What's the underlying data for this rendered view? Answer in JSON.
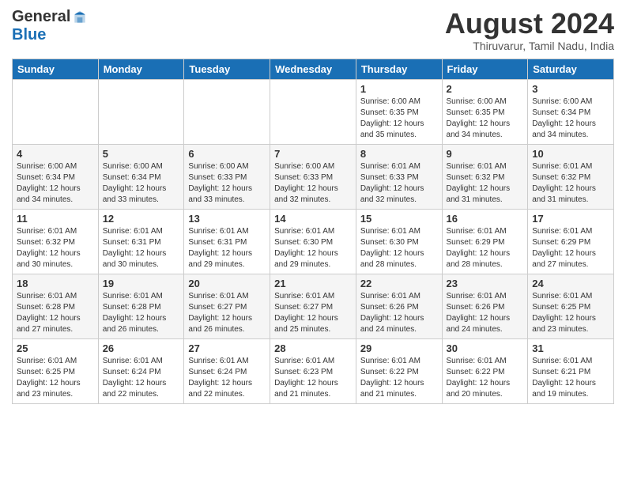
{
  "logo": {
    "general": "General",
    "blue": "Blue"
  },
  "header": {
    "title": "August 2024",
    "subtitle": "Thiruvarur, Tamil Nadu, India"
  },
  "days_of_week": [
    "Sunday",
    "Monday",
    "Tuesday",
    "Wednesday",
    "Thursday",
    "Friday",
    "Saturday"
  ],
  "weeks": [
    [
      {
        "num": "",
        "info": ""
      },
      {
        "num": "",
        "info": ""
      },
      {
        "num": "",
        "info": ""
      },
      {
        "num": "",
        "info": ""
      },
      {
        "num": "1",
        "info": "Sunrise: 6:00 AM\nSunset: 6:35 PM\nDaylight: 12 hours\nand 35 minutes."
      },
      {
        "num": "2",
        "info": "Sunrise: 6:00 AM\nSunset: 6:35 PM\nDaylight: 12 hours\nand 34 minutes."
      },
      {
        "num": "3",
        "info": "Sunrise: 6:00 AM\nSunset: 6:34 PM\nDaylight: 12 hours\nand 34 minutes."
      }
    ],
    [
      {
        "num": "4",
        "info": "Sunrise: 6:00 AM\nSunset: 6:34 PM\nDaylight: 12 hours\nand 34 minutes."
      },
      {
        "num": "5",
        "info": "Sunrise: 6:00 AM\nSunset: 6:34 PM\nDaylight: 12 hours\nand 33 minutes."
      },
      {
        "num": "6",
        "info": "Sunrise: 6:00 AM\nSunset: 6:33 PM\nDaylight: 12 hours\nand 33 minutes."
      },
      {
        "num": "7",
        "info": "Sunrise: 6:00 AM\nSunset: 6:33 PM\nDaylight: 12 hours\nand 32 minutes."
      },
      {
        "num": "8",
        "info": "Sunrise: 6:01 AM\nSunset: 6:33 PM\nDaylight: 12 hours\nand 32 minutes."
      },
      {
        "num": "9",
        "info": "Sunrise: 6:01 AM\nSunset: 6:32 PM\nDaylight: 12 hours\nand 31 minutes."
      },
      {
        "num": "10",
        "info": "Sunrise: 6:01 AM\nSunset: 6:32 PM\nDaylight: 12 hours\nand 31 minutes."
      }
    ],
    [
      {
        "num": "11",
        "info": "Sunrise: 6:01 AM\nSunset: 6:32 PM\nDaylight: 12 hours\nand 30 minutes."
      },
      {
        "num": "12",
        "info": "Sunrise: 6:01 AM\nSunset: 6:31 PM\nDaylight: 12 hours\nand 30 minutes."
      },
      {
        "num": "13",
        "info": "Sunrise: 6:01 AM\nSunset: 6:31 PM\nDaylight: 12 hours\nand 29 minutes."
      },
      {
        "num": "14",
        "info": "Sunrise: 6:01 AM\nSunset: 6:30 PM\nDaylight: 12 hours\nand 29 minutes."
      },
      {
        "num": "15",
        "info": "Sunrise: 6:01 AM\nSunset: 6:30 PM\nDaylight: 12 hours\nand 28 minutes."
      },
      {
        "num": "16",
        "info": "Sunrise: 6:01 AM\nSunset: 6:29 PM\nDaylight: 12 hours\nand 28 minutes."
      },
      {
        "num": "17",
        "info": "Sunrise: 6:01 AM\nSunset: 6:29 PM\nDaylight: 12 hours\nand 27 minutes."
      }
    ],
    [
      {
        "num": "18",
        "info": "Sunrise: 6:01 AM\nSunset: 6:28 PM\nDaylight: 12 hours\nand 27 minutes."
      },
      {
        "num": "19",
        "info": "Sunrise: 6:01 AM\nSunset: 6:28 PM\nDaylight: 12 hours\nand 26 minutes."
      },
      {
        "num": "20",
        "info": "Sunrise: 6:01 AM\nSunset: 6:27 PM\nDaylight: 12 hours\nand 26 minutes."
      },
      {
        "num": "21",
        "info": "Sunrise: 6:01 AM\nSunset: 6:27 PM\nDaylight: 12 hours\nand 25 minutes."
      },
      {
        "num": "22",
        "info": "Sunrise: 6:01 AM\nSunset: 6:26 PM\nDaylight: 12 hours\nand 24 minutes."
      },
      {
        "num": "23",
        "info": "Sunrise: 6:01 AM\nSunset: 6:26 PM\nDaylight: 12 hours\nand 24 minutes."
      },
      {
        "num": "24",
        "info": "Sunrise: 6:01 AM\nSunset: 6:25 PM\nDaylight: 12 hours\nand 23 minutes."
      }
    ],
    [
      {
        "num": "25",
        "info": "Sunrise: 6:01 AM\nSunset: 6:25 PM\nDaylight: 12 hours\nand 23 minutes."
      },
      {
        "num": "26",
        "info": "Sunrise: 6:01 AM\nSunset: 6:24 PM\nDaylight: 12 hours\nand 22 minutes."
      },
      {
        "num": "27",
        "info": "Sunrise: 6:01 AM\nSunset: 6:24 PM\nDaylight: 12 hours\nand 22 minutes."
      },
      {
        "num": "28",
        "info": "Sunrise: 6:01 AM\nSunset: 6:23 PM\nDaylight: 12 hours\nand 21 minutes."
      },
      {
        "num": "29",
        "info": "Sunrise: 6:01 AM\nSunset: 6:22 PM\nDaylight: 12 hours\nand 21 minutes."
      },
      {
        "num": "30",
        "info": "Sunrise: 6:01 AM\nSunset: 6:22 PM\nDaylight: 12 hours\nand 20 minutes."
      },
      {
        "num": "31",
        "info": "Sunrise: 6:01 AM\nSunset: 6:21 PM\nDaylight: 12 hours\nand 19 minutes."
      }
    ]
  ]
}
